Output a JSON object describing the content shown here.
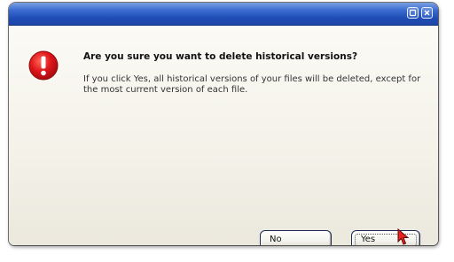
{
  "dialog": {
    "title": "",
    "question": "Are you sure you want to delete historical versions?",
    "message": "If you click Yes, all historical versions of your files will be deleted, except for the most current version of each file.",
    "icon": "warning-exclamation-icon",
    "icon_color": "#e0161b"
  },
  "titlebar": {
    "color": "#2a59c4",
    "buttons": [
      "minimize-icon",
      "close-icon"
    ]
  },
  "buttons": {
    "no_label": "No",
    "yes_label": "Yes"
  }
}
